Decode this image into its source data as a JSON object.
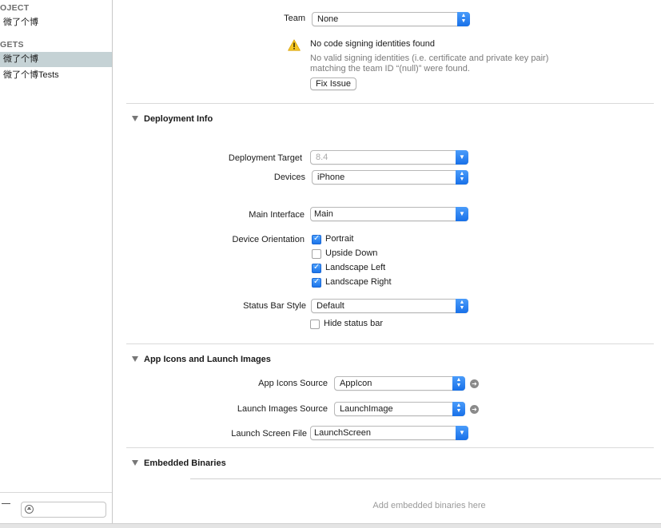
{
  "sidebar": {
    "project_header": "OJECT",
    "project_item": "微了个博",
    "targets_header": "GETS",
    "targets": [
      {
        "label": "微了个博",
        "selected": true
      },
      {
        "label": "微了个博Tests",
        "selected": false
      }
    ],
    "filter_placeholder": ""
  },
  "signing": {
    "team_label": "Team",
    "team_value": "None",
    "warning_title": "No code signing identities found",
    "warning_detail_1": "No valid signing identities (i.e. certificate and private key pair)",
    "warning_detail_2": "matching the team ID “(null)” were found.",
    "fix_issue_label": "Fix Issue"
  },
  "deployment": {
    "title": "Deployment Info",
    "target_label": "Deployment Target",
    "target_value": "8.4",
    "devices_label": "Devices",
    "devices_value": "iPhone",
    "main_interface_label": "Main Interface",
    "main_interface_value": "Main",
    "orientation_label": "Device Orientation",
    "orientations": [
      {
        "label": "Portrait",
        "checked": true
      },
      {
        "label": "Upside Down",
        "checked": false
      },
      {
        "label": "Landscape Left",
        "checked": true
      },
      {
        "label": "Landscape Right",
        "checked": true
      }
    ],
    "status_bar_label": "Status Bar Style",
    "status_bar_value": "Default",
    "hide_status_bar_label": "Hide status bar",
    "hide_status_bar_checked": false
  },
  "app_icons": {
    "title": "App Icons and Launch Images",
    "icons_source_label": "App Icons Source",
    "icons_source_value": "AppIcon",
    "launch_images_label": "Launch Images Source",
    "launch_images_value": "LaunchImage",
    "launch_screen_label": "Launch Screen File",
    "launch_screen_value": "LaunchScreen"
  },
  "embedded": {
    "title": "Embedded Binaries",
    "placeholder": "Add embedded binaries here"
  },
  "colors": {
    "accent": "#1b74ea",
    "selection": "#c5d2d5",
    "warning": "#f5c623"
  },
  "icons": {
    "warning": "warning-triangle-icon",
    "disclosure": "disclosure-triangle-icon",
    "go": "arrow-right-circle-icon",
    "filter": "filter-icon"
  }
}
